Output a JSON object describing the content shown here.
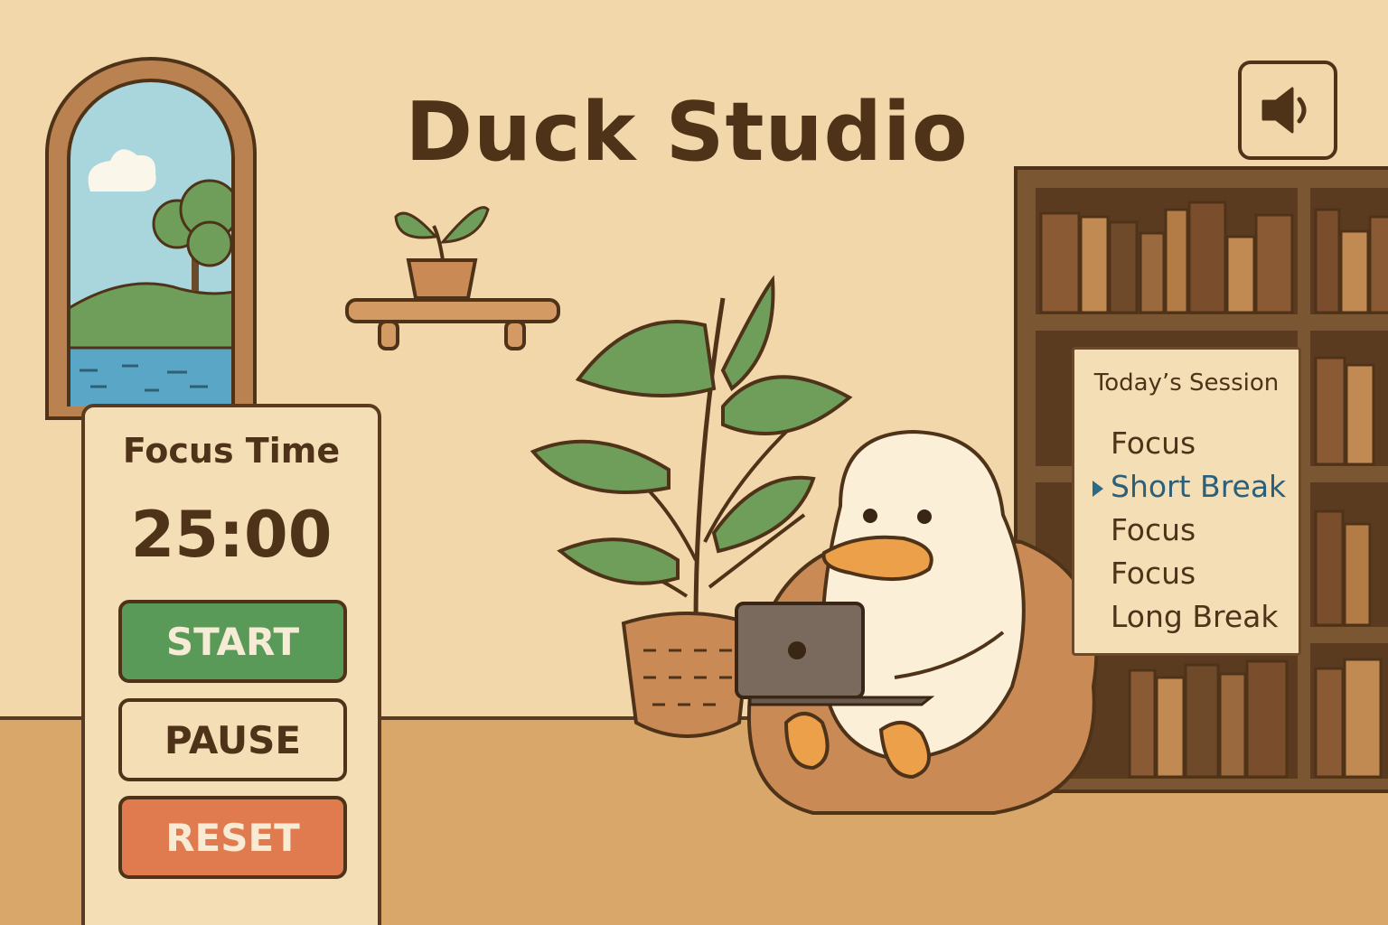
{
  "app": {
    "title": "Duck Studio"
  },
  "sound": {
    "icon": "speaker-icon"
  },
  "timer": {
    "label": "Focus Time",
    "value": "25:00",
    "buttons": {
      "start": "START",
      "pause": "PAUSE",
      "reset": "RESET"
    }
  },
  "session": {
    "title": "Today’s Session",
    "items": [
      {
        "label": "Focus",
        "active": false
      },
      {
        "label": "Short Break",
        "active": true
      },
      {
        "label": "Focus",
        "active": false
      },
      {
        "label": "Focus",
        "active": false
      },
      {
        "label": "Long Break",
        "active": false
      }
    ]
  },
  "colors": {
    "background": "#f2d7ab",
    "outline": "#4f3319",
    "start": "#5a9a58",
    "reset": "#e07a4f",
    "active_item": "#2b5f7a"
  }
}
